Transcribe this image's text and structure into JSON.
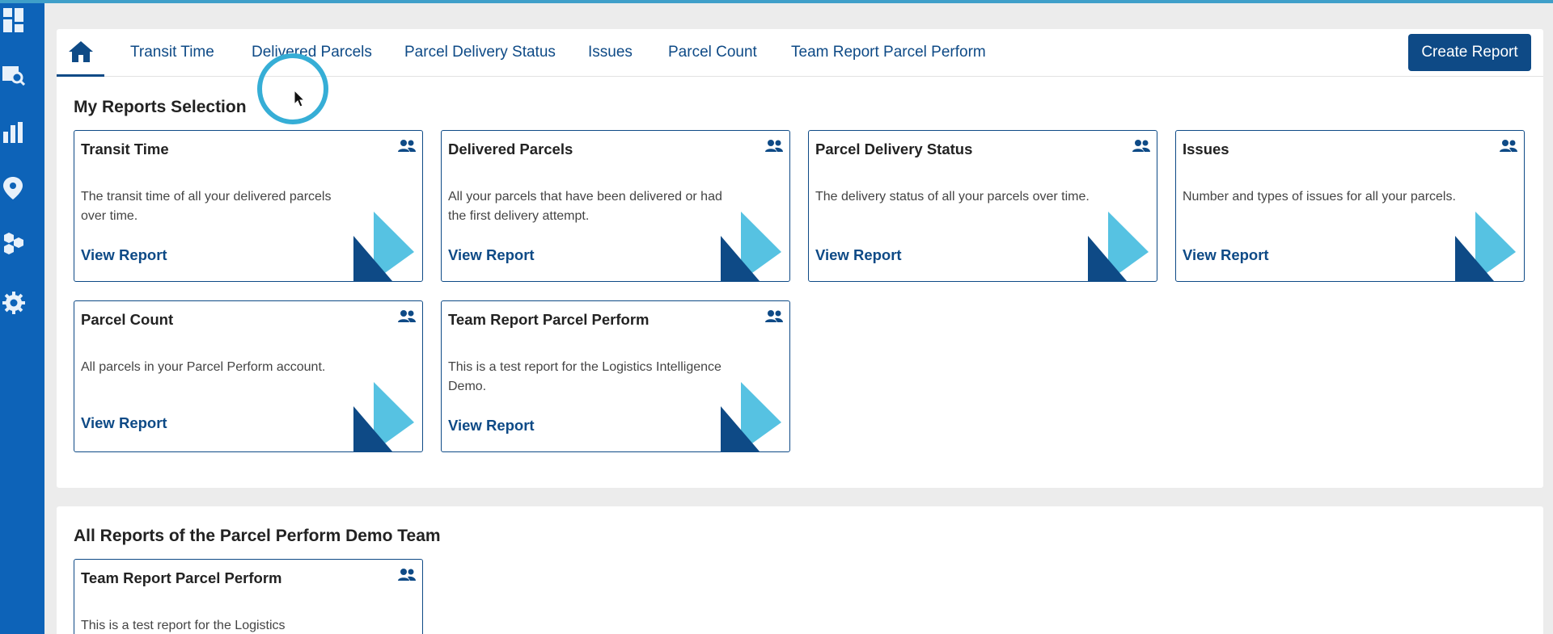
{
  "colors": {
    "sidebar": "#0d63b8",
    "brand": "#0e4a86",
    "accent": "#36aed6",
    "logo_dark": "#0e4a86",
    "logo_light": "#56c2e2"
  },
  "sidebar": {
    "icons": [
      "dashboard-icon",
      "parcel-search-icon",
      "bar-chart-icon",
      "map-pin-icon",
      "hexagons-icon",
      "settings-icon"
    ]
  },
  "tabs": {
    "home_icon": "home-icon",
    "items": [
      {
        "label": "Transit Time"
      },
      {
        "label": "Delivered Parcels"
      },
      {
        "label": "Parcel Delivery Status"
      },
      {
        "label": "Issues"
      },
      {
        "label": "Parcel Count"
      },
      {
        "label": "Team Report Parcel Perform"
      }
    ],
    "create_button": "Create Report"
  },
  "my_reports": {
    "title": "My Reports Selection",
    "cards": [
      {
        "title": "Transit Time",
        "description": "The transit time of all your delivered parcels over time.",
        "link": "View Report"
      },
      {
        "title": "Delivered Parcels",
        "description": "All your parcels that have been delivered or had the first delivery attempt.",
        "link": "View Report"
      },
      {
        "title": "Parcel Delivery Status",
        "description": "The delivery status of all your parcels over time.",
        "link": "View Report"
      },
      {
        "title": "Issues",
        "description": "Number and types of issues for all your parcels.",
        "link": "View Report"
      },
      {
        "title": "Parcel Count",
        "description": "All parcels in your Parcel Perform account.",
        "link": "View Report"
      },
      {
        "title": "Team Report Parcel Perform",
        "description": "This is a test report for the Logistics Intelligence Demo.",
        "link": "View Report"
      }
    ]
  },
  "team_reports": {
    "title": "All Reports of the Parcel Perform Demo Team",
    "cards": [
      {
        "title": "Team Report Parcel Perform",
        "description": "This is a test report for the Logistics"
      }
    ]
  }
}
